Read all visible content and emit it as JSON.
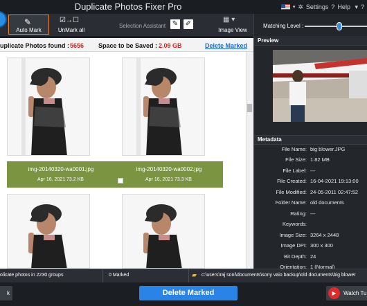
{
  "app": {
    "title": "Duplicate Photos Fixer Pro"
  },
  "topbar": {
    "settings": "Settings",
    "help": "Help",
    "arrow_more": "?"
  },
  "toolbar": {
    "auto_mark": "Auto Mark",
    "unmark_all": "UnMark all",
    "selection_assistant": "Selection Assistant",
    "image_view": "Image View"
  },
  "matching": {
    "label": "Matching Level :",
    "level": 0.55
  },
  "infobar": {
    "found_label": "uplicate Photos found :",
    "found_value": "5656",
    "space_label": "Space to be Saved :",
    "space_value": "2.09 GB",
    "delete_link": "Delete Marked"
  },
  "grid": {
    "items": [
      {
        "filename": "img-20140320-wa0001.jpg",
        "date": "Apr 16, 2021",
        "size": "73.2 KB",
        "checked": false
      },
      {
        "filename": "img-20140320-wa0002.jpg",
        "date": "Apr 16, 2021",
        "size": "73.3 KB",
        "checked": false
      }
    ]
  },
  "preview": {
    "title": "Preview"
  },
  "metadata": {
    "title": "Metadata",
    "fields": [
      {
        "key": "File Name:",
        "value": "big blower.JPG"
      },
      {
        "key": "File Size:",
        "value": "1.82 MB"
      },
      {
        "key": "File Label:",
        "value": "---"
      },
      {
        "key": "File Created:",
        "value": "16-04-2021 19:13:00"
      },
      {
        "key": "File Modified:",
        "value": "24-05-2011 02:47:52"
      },
      {
        "key": "Folder Name:",
        "value": "old documents"
      },
      {
        "key": "Rating:",
        "value": "---"
      },
      {
        "key": "Keywords:",
        "value": ""
      },
      {
        "key": "Image Size:",
        "value": "3264 x 2448"
      },
      {
        "key": "Image DPI:",
        "value": "300 x 300"
      },
      {
        "key": "Bit Depth:",
        "value": "24"
      },
      {
        "key": "Orientation:",
        "value": "1 (Normal)"
      }
    ]
  },
  "status": {
    "groups": "olicate photos in 2230 groups",
    "marked": "0 Marked",
    "path": "c:\\users\\raj soni\\documents\\sony vaio backup\\old documents\\big blower"
  },
  "bottom": {
    "back": "k",
    "delete": "Delete Marked",
    "watch": "Watch Tu"
  },
  "colors": {
    "accent": "#f0841f",
    "link": "#1e6bd6",
    "danger": "#e0231a",
    "caption": "#7a9442",
    "primary": "#2a83e7"
  }
}
